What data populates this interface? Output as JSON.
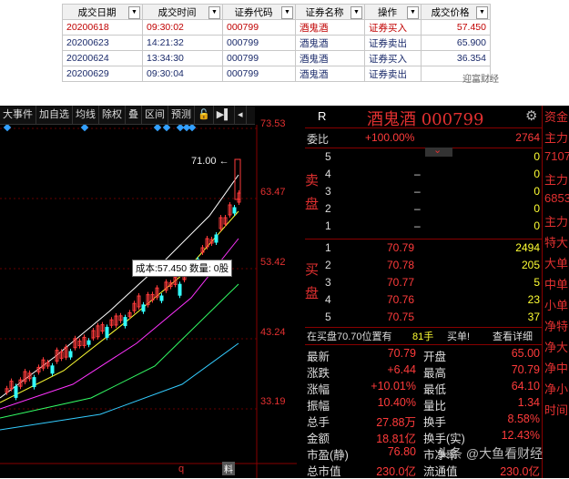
{
  "trade_table": {
    "headers": [
      "成交日期",
      "成交时间",
      "证券代码",
      "证券名称",
      "操作",
      "成交价格"
    ],
    "rows": [
      [
        "20200618",
        "09:30:02",
        "000799",
        "酒鬼酒",
        "证券买入",
        "57.450"
      ],
      [
        "20200623",
        "14:21:32",
        "000799",
        "酒鬼酒",
        "证券卖出",
        "65.900"
      ],
      [
        "20200624",
        "13:34:30",
        "000799",
        "酒鬼酒",
        "证券买入",
        "36.354"
      ],
      [
        "20200629",
        "09:30:04",
        "000799",
        "酒鬼酒",
        "证券卖出",
        ""
      ]
    ],
    "watermark": "迎富财经"
  },
  "toolbar": {
    "items": [
      "大事件",
      "加自选",
      "均线",
      "除权",
      "叠",
      "区间",
      "预测"
    ],
    "icons": [
      "lock-icon",
      "play-icon",
      "collapse-icon"
    ]
  },
  "chart": {
    "y_labels": [
      "73.53",
      "63.47",
      "53.42",
      "43.24",
      "33.19"
    ],
    "high_label": "71.00",
    "cost_tip": "成本:57.450 数量: 0股",
    "bottom_marks": [
      "q",
      "料"
    ]
  },
  "quote": {
    "r_label": "R",
    "title": "酒鬼酒 000799",
    "weibi_label": "委比",
    "weibi_value": "+100.00%",
    "weibi_diff": "2764",
    "sell_label": "卖盘",
    "buy_label": "买盘",
    "sell": [
      {
        "lvl": "5",
        "price": "",
        "vol": "0"
      },
      {
        "lvl": "4",
        "price": "–",
        "vol": "0"
      },
      {
        "lvl": "3",
        "price": "–",
        "vol": "0"
      },
      {
        "lvl": "2",
        "price": "–",
        "vol": "0"
      },
      {
        "lvl": "1",
        "price": "–",
        "vol": "0"
      }
    ],
    "buy": [
      {
        "lvl": "1",
        "price": "70.79",
        "vol": "2494"
      },
      {
        "lvl": "2",
        "price": "70.78",
        "vol": "205"
      },
      {
        "lvl": "3",
        "price": "70.77",
        "vol": "5"
      },
      {
        "lvl": "4",
        "price": "70.76",
        "vol": "23"
      },
      {
        "lvl": "5",
        "price": "70.75",
        "vol": "37"
      }
    ],
    "tally_left": "在买盘70.70位置有",
    "tally_vol": "81手",
    "tally_act": "买单!",
    "tally_link": "查看详细",
    "stats": [
      {
        "l1": "最新",
        "v1": "70.79",
        "l2": "开盘",
        "v2": "65.00"
      },
      {
        "l1": "涨跌",
        "v1": "+6.44",
        "l2": "最高",
        "v2": "70.79"
      },
      {
        "l1": "涨幅",
        "v1": "+10.01%",
        "l2": "最低",
        "v2": "64.10"
      },
      {
        "l1": "振幅",
        "v1": "10.40%",
        "l2": "量比",
        "v2": "1.34"
      },
      {
        "l1": "总手",
        "v1": "27.88万",
        "l2": "换手",
        "v2": "8.58%"
      },
      {
        "l1": "金额",
        "v1": "18.81亿",
        "l2": "换手(实)",
        "v2": "12.43%"
      },
      {
        "l1": "市盈(静)",
        "v1": "76.80",
        "l2": "市净率",
        "v2": ""
      },
      {
        "l1": "总市值",
        "v1": "230.0亿",
        "l2": "流通值",
        "v2": "230.0亿"
      }
    ]
  },
  "strip": {
    "items": [
      "资金",
      "主力",
      "7107",
      "主力",
      "6853",
      "主力",
      "特大",
      "大单",
      "中单",
      "小单",
      "净特",
      "净大",
      "净中",
      "净小",
      "时间"
    ]
  },
  "watermark_bottom": "头条 @大鱼看财经"
}
